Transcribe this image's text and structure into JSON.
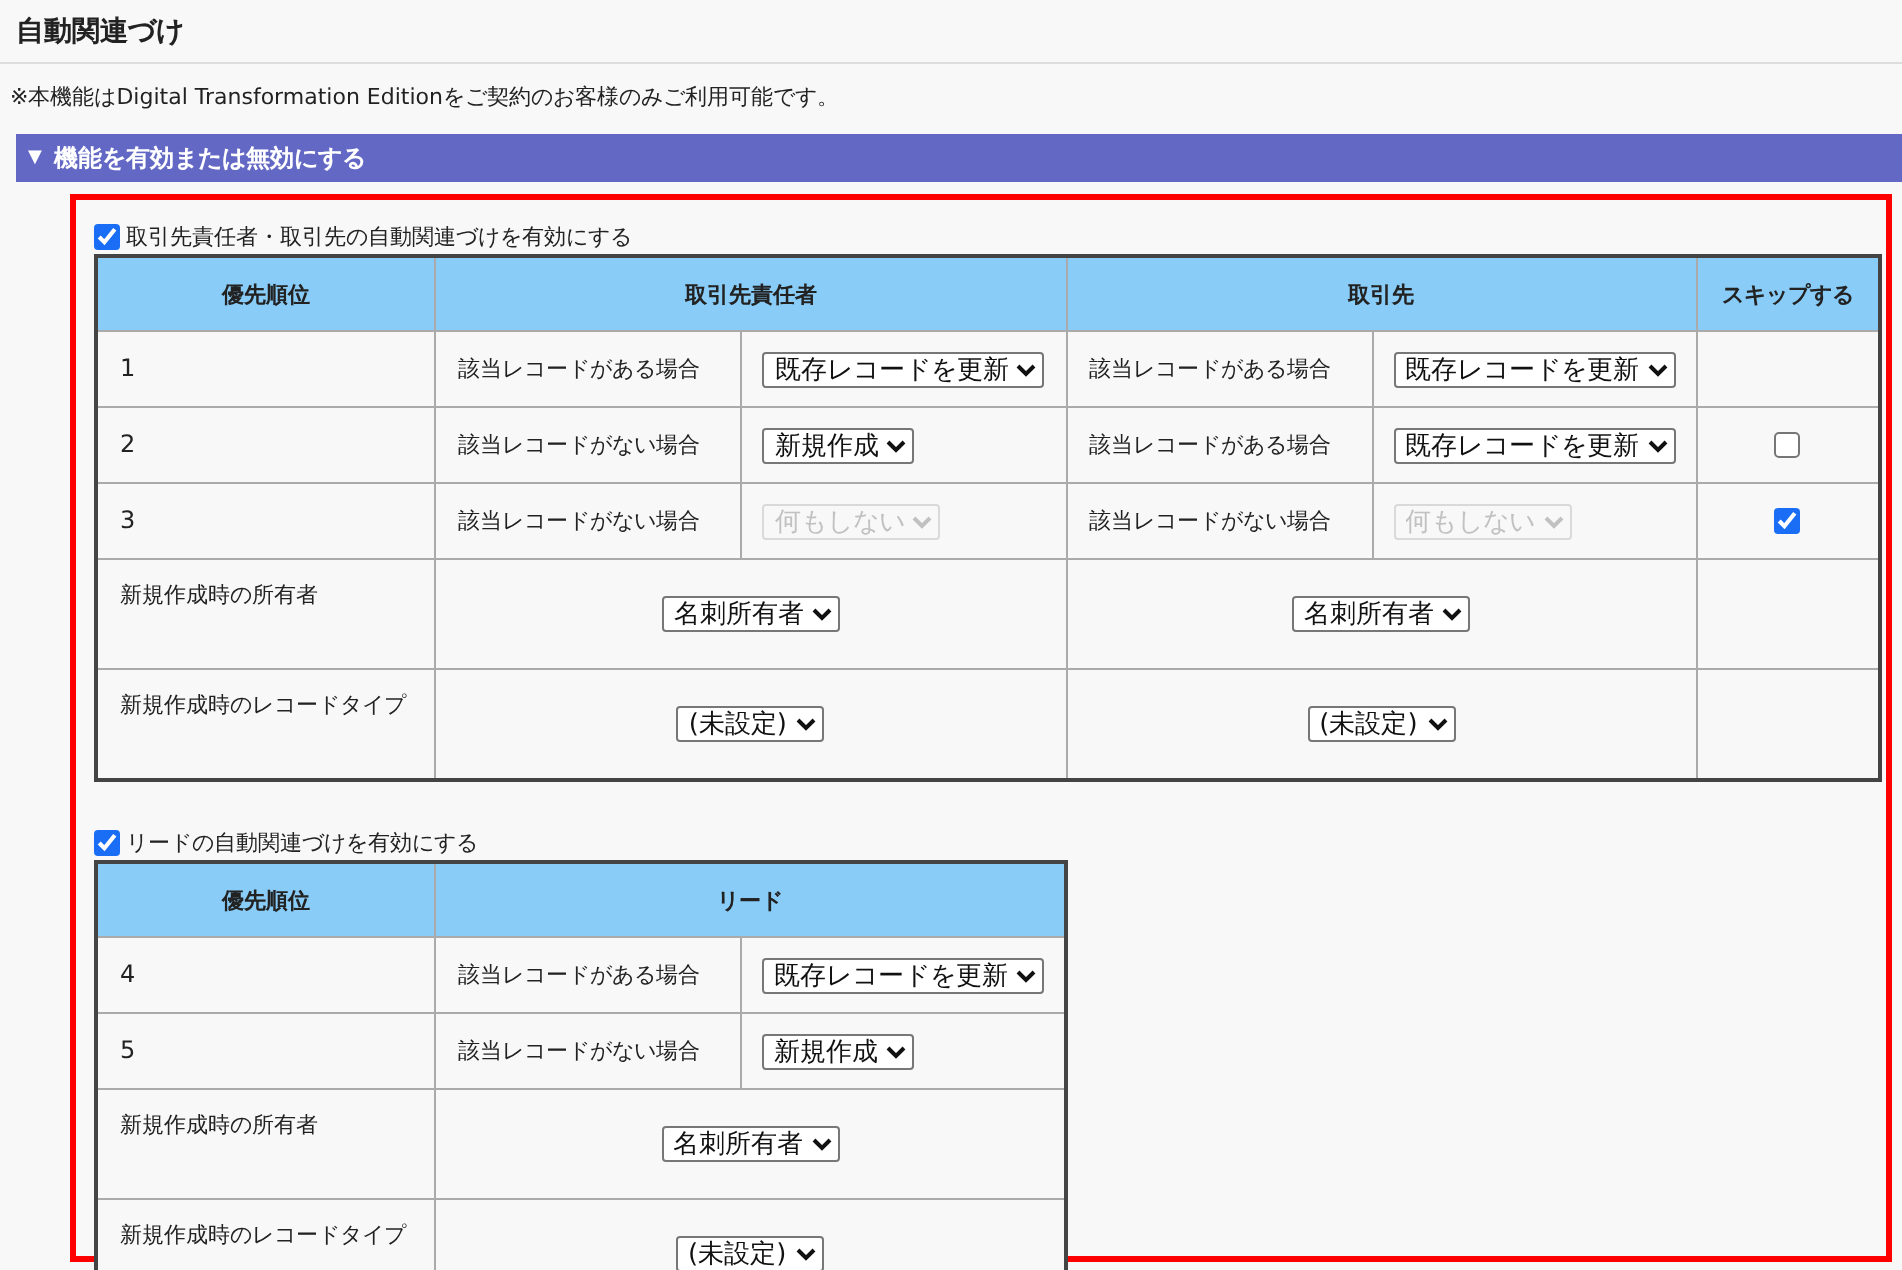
{
  "title": "自動関連づけ",
  "note": "※本機能はDigital Transformation Editionをご契約のお客様のみご利用可能です。",
  "section": {
    "label": "機能を有効または無効にする",
    "expanded": true,
    "toggle": "▼"
  },
  "groups": [
    {
      "label": "取引先責任者・取引先の自動関連づけを有効にする",
      "enabled": true,
      "priority_header": "優先順位",
      "objects": [
        "取引先責任者",
        "取引先"
      ],
      "skip_header": "スキップする",
      "rows": [
        {
          "priority": "1",
          "cells": [
            {
              "condition": "該当レコードがある場合",
              "action": "既存レコードを更新",
              "disabled": false
            },
            {
              "condition": "該当レコードがある場合",
              "action": "既存レコードを更新",
              "disabled": false
            }
          ]
        },
        {
          "priority": "2",
          "cells": [
            {
              "condition": "該当レコードがない場合",
              "action": "新規作成",
              "disabled": false
            },
            {
              "condition": "該当レコードがある場合",
              "action": "既存レコードを更新",
              "disabled": false
            }
          ],
          "skip": false
        },
        {
          "priority": "3",
          "cells": [
            {
              "condition": "該当レコードがない場合",
              "action": "何もしない",
              "disabled": true
            },
            {
              "condition": "該当レコードがない場合",
              "action": "何もしない",
              "disabled": true
            }
          ],
          "skip": true
        }
      ],
      "settings": [
        {
          "label": "新規作成時の所有者",
          "values": [
            "名刺所有者",
            "名刺所有者"
          ]
        },
        {
          "label": "新規作成時のレコードタイプ",
          "values": [
            "(未設定)",
            "(未設定)"
          ]
        }
      ]
    },
    {
      "label": "リードの自動関連づけを有効にする",
      "enabled": true,
      "priority_header": "優先順位",
      "objects": [
        "リード"
      ],
      "rows": [
        {
          "priority": "4",
          "cells": [
            {
              "condition": "該当レコードがある場合",
              "action": "既存レコードを更新",
              "disabled": false
            }
          ]
        },
        {
          "priority": "5",
          "cells": [
            {
              "condition": "該当レコードがない場合",
              "action": "新規作成",
              "disabled": false
            }
          ]
        }
      ],
      "settings": [
        {
          "label": "新規作成時の所有者",
          "values": [
            "名刺所有者"
          ]
        },
        {
          "label": "新規作成時のレコードタイプ",
          "values": [
            "(未設定)"
          ]
        }
      ]
    }
  ]
}
